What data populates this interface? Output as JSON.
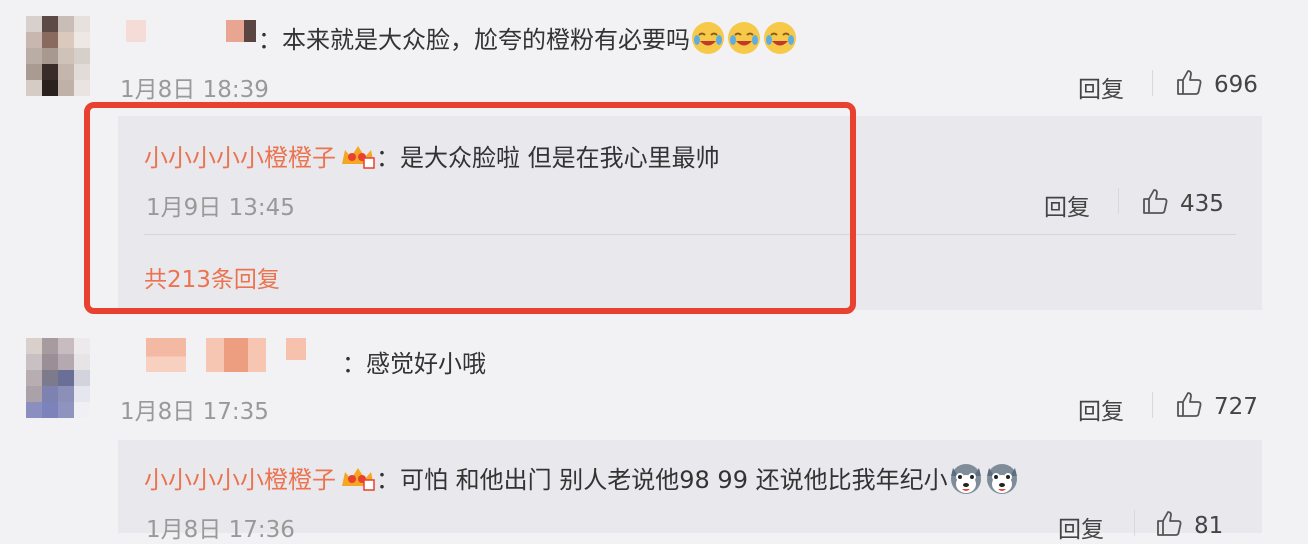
{
  "comments": [
    {
      "separator": "：",
      "text": "本来就是大众脸，尬夸的橙粉有必要吗",
      "time": "1月8日 18:39",
      "reply_label": "回复",
      "likes": "696",
      "emoji": [
        "laughing-tear-emoji",
        "laughing-tear-emoji",
        "laughing-tear-emoji"
      ]
    },
    {
      "separator": "：",
      "text": "感觉好小哦",
      "time": "1月8日 17:35",
      "reply_label": "回复",
      "likes": "727"
    }
  ],
  "sub_replies": [
    {
      "username": "小小小小小橙橙子",
      "separator": "：",
      "text": "是大众脸啦 但是在我心里最帅",
      "time": "1月9日 13:45",
      "reply_label": "回复",
      "likes": "435",
      "more_label": "共213条回复"
    },
    {
      "username": "小小小小小橙橙子",
      "separator": "：",
      "text": "可怕 和他出门 别人老说他98 99 还说他比我年纪小",
      "time": "1月8日 17:36",
      "reply_label": "回复",
      "likes": "81",
      "emoji": [
        "husky-emoji",
        "husky-emoji"
      ]
    }
  ],
  "colors": {
    "accent": "#eb7350",
    "highlight_box": "#e8412f",
    "background": "#f2f2f5",
    "subreply_bg": "#e9e9ed"
  }
}
